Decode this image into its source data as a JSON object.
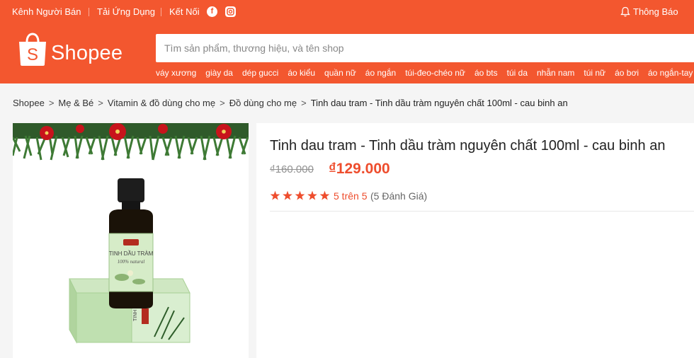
{
  "topbar": {
    "seller_center": "Kênh Người Bán",
    "download_app": "Tải Ứng Dụng",
    "connect": "Kết Nối",
    "notifications": "Thông Báo"
  },
  "logo": {
    "text": "Shopee",
    "bag_letter": "S"
  },
  "search": {
    "placeholder": "Tìm sản phẩm, thương hiệu, và tên shop"
  },
  "hints": [
    "váy xương",
    "giày da",
    "dép gucci",
    "áo kiểu",
    "quần nữ",
    "áo ngắn",
    "túi-đeo-chéo nữ",
    "áo bts",
    "túi da",
    "nhẫn nam",
    "túi nữ",
    "áo bơi",
    "áo ngắn-tay"
  ],
  "breadcrumb": {
    "items": [
      "Shopee",
      "Mẹ & Bé",
      "Vitamin & đồ dùng cho mẹ",
      "Đồ dùng cho mẹ"
    ],
    "current": "Tinh dau tram - Tinh dầu tràm nguyên chất 100ml - cau binh an"
  },
  "product": {
    "title": "Tinh dau tram - Tinh dầu tràm nguyên chất 100ml - cau binh an",
    "original_price": "₫160.000",
    "price": "₫129.000",
    "rating_text": "5 trên 5",
    "review_count": "(5 Đánh Giá)",
    "rating_value": 5,
    "rating_max": 5,
    "label_text": "TINH DẦU TRÀM",
    "label_natural": "100% natural"
  },
  "colors": {
    "brand": "#f3572f",
    "price": "#ee4d2d",
    "star": "#ee4d2d"
  }
}
